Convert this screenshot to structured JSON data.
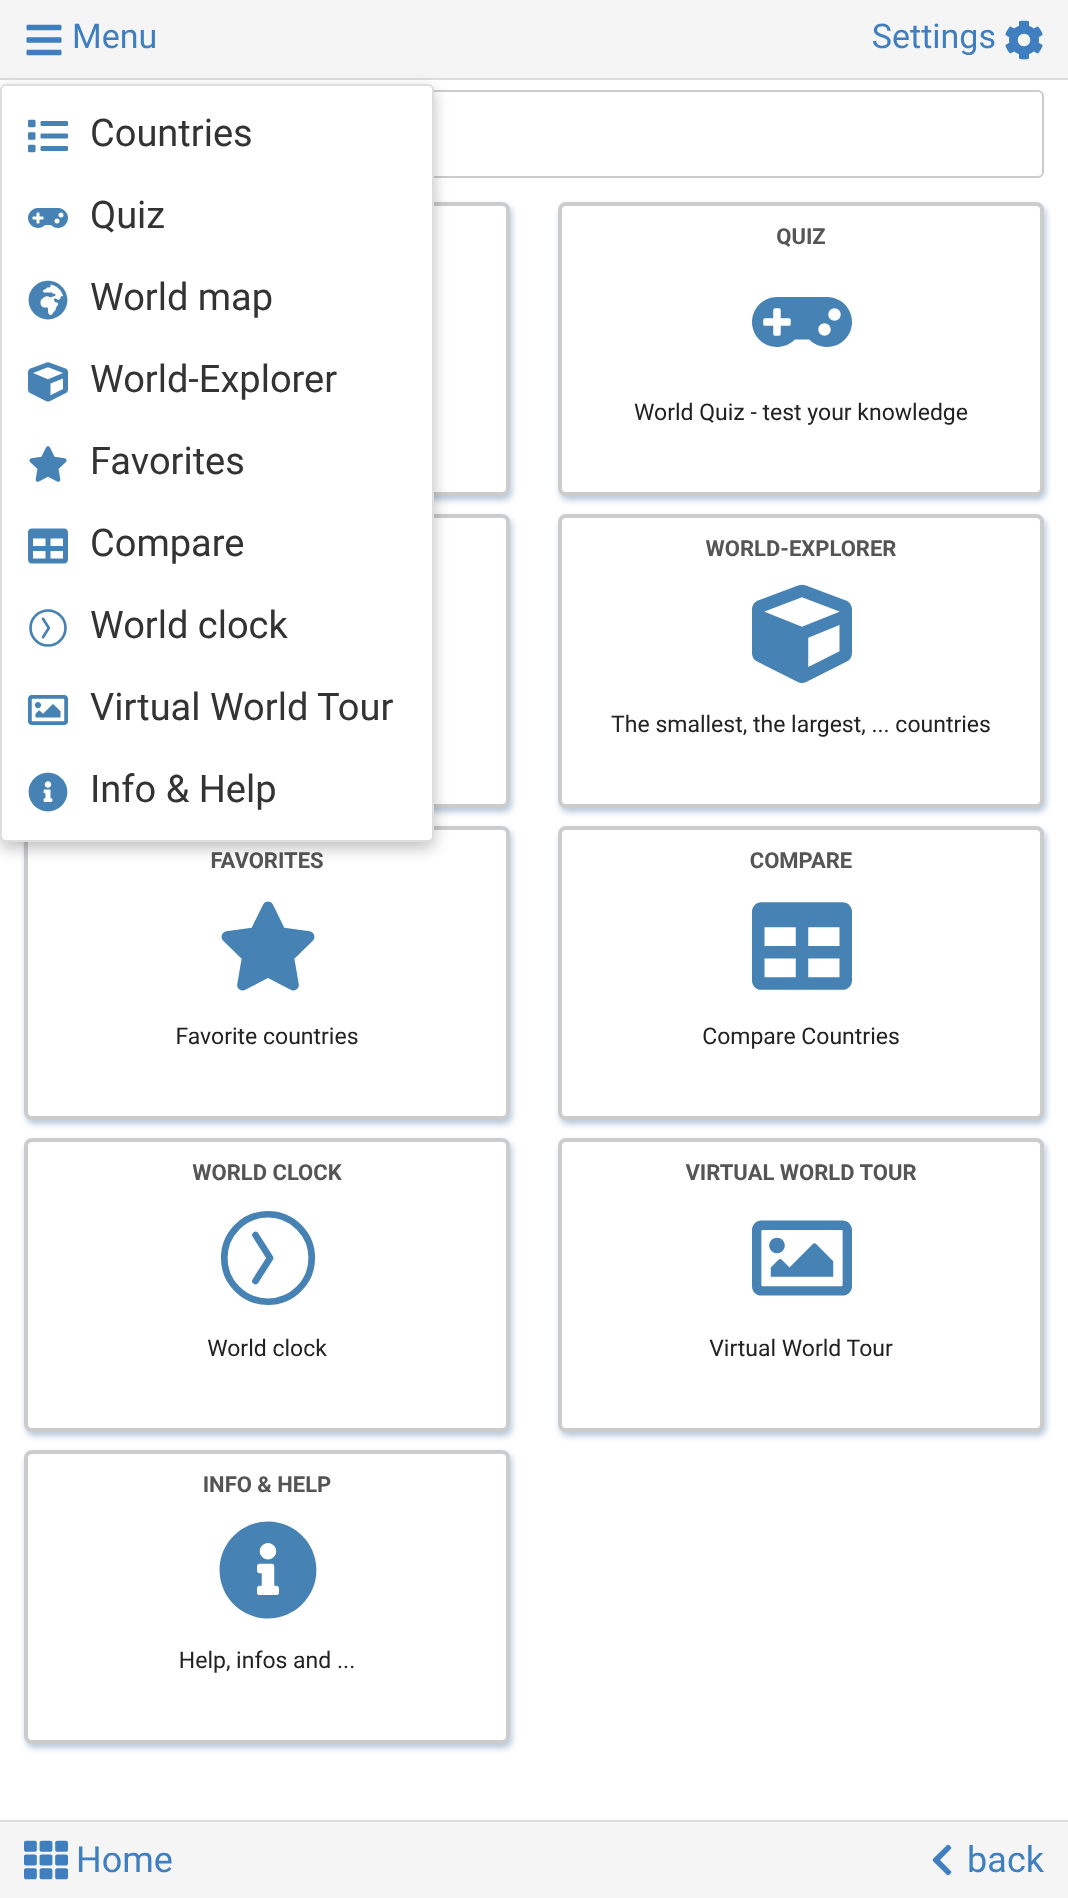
{
  "header": {
    "menu_label": "Menu",
    "settings_label": "Settings"
  },
  "menu": {
    "open": true,
    "items": [
      {
        "label": "Countries"
      },
      {
        "label": "Quiz"
      },
      {
        "label": "World map"
      },
      {
        "label": "World-Explorer"
      },
      {
        "label": "Favorites"
      },
      {
        "label": "Compare"
      },
      {
        "label": "World clock"
      },
      {
        "label": "Virtual World Tour"
      },
      {
        "label": "Info & Help"
      }
    ]
  },
  "card_rows": [
    {
      "right": {
        "title": "QUIZ",
        "description": "World Quiz - test your knowledge"
      }
    },
    {
      "right": {
        "title": "WORLD-EXPLORER",
        "description": "The smallest, the largest, ... countries"
      }
    },
    {
      "left": {
        "title": "FAVORITES",
        "description": "Favorite countries"
      },
      "right": {
        "title": "COMPARE",
        "description": "Compare Countries"
      }
    },
    {
      "left": {
        "title": "WORLD CLOCK",
        "description": "World clock"
      },
      "right": {
        "title": "VIRTUAL WORLD TOUR",
        "description": "Virtual World Tour"
      }
    },
    {
      "left": {
        "title": "INFO & HELP",
        "description": "Help, infos and ..."
      }
    }
  ],
  "footer": {
    "home_label": "Home",
    "back_label": "back"
  }
}
